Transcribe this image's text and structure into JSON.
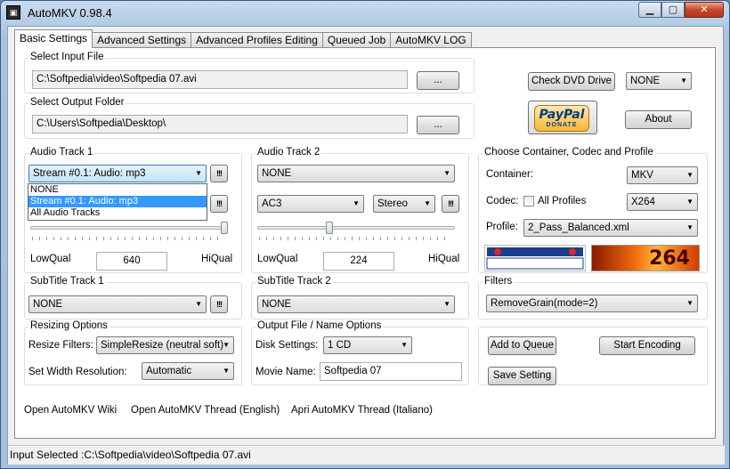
{
  "window": {
    "title": "AutoMKV 0.98.4"
  },
  "tabs": [
    "Basic Settings",
    "Advanced Settings",
    "Advanced Profiles Editing",
    "Queued Job",
    "AutoMKV LOG"
  ],
  "input": {
    "group_title": "Select Input File",
    "value": "C:\\Softpedia\\video\\Softpedia 07.avi",
    "browse_label": "..."
  },
  "output": {
    "group_title": "Select Output Folder",
    "value": "C:\\Users\\Softpedia\\Desktop\\",
    "browse_label": "..."
  },
  "dvd": {
    "check_label": "Check DVD Drive",
    "drive_value": "NONE"
  },
  "paypal": {
    "logo_text": "PayPal",
    "donate_text": "DONATE"
  },
  "about_label": "About",
  "audio1": {
    "title": "Audio Track 1",
    "selected": "Stream #0.1: Audio: mp3",
    "options": [
      "NONE",
      "Stream #0.1: Audio: mp3",
      "All Audio Tracks"
    ],
    "selected_index": 1,
    "extra_label": "!!!",
    "low": "LowQual",
    "high": "HiQual",
    "bitrate": "640",
    "slider_level": 1.0
  },
  "audio2": {
    "title": "Audio Track 2",
    "selected": "NONE",
    "codec": "AC3",
    "channels": "Stereo",
    "extra_label": "!!!",
    "low": "LowQual",
    "high": "HiQual",
    "bitrate": "224",
    "slider_level": 0.36
  },
  "container": {
    "title": "Choose Container, Codec and Profile",
    "container_label": "Container:",
    "container_value": "MKV",
    "codec_label": "Codec:",
    "all_profiles_label": "All Profiles",
    "all_profiles_checked": false,
    "codec_value": "X264",
    "profile_label": "Profile:",
    "profile_value": "2_Pass_Balanced.xml",
    "logo_matroska": "МАТРЁШКА MATROSKA",
    "logo_264": "264"
  },
  "subtitle1": {
    "title": "SubTitle Track 1",
    "selected": "NONE",
    "extra_label": "!!!"
  },
  "subtitle2": {
    "title": "SubTitle Track 2",
    "selected": "NONE"
  },
  "filters": {
    "title": "Filters",
    "selected": "RemoveGrain(mode=2)"
  },
  "resizing": {
    "title": "Resizing Options",
    "filters_label": "Resize Filters:",
    "filters_value": "SimpleResize (neutral soft)",
    "width_label": "Set Width Resolution:",
    "width_value": "Automatic"
  },
  "outfile": {
    "title": "Output File / Name Options",
    "disk_label": "Disk Settings:",
    "disk_value": "1 CD",
    "movie_label": "Movie Name:",
    "movie_value": "Softpedia 07"
  },
  "actions": {
    "add_queue": "Add to Queue",
    "start_encoding": "Start Encoding",
    "save_setting": "Save Setting"
  },
  "links": [
    "Open AutoMKV Wiki",
    "Open AutoMKV Thread (English)",
    "Apri AutoMKV Thread (Italiano)"
  ],
  "status": "Input Selected :C:\\Softpedia\\video\\Softpedia 07.avi"
}
